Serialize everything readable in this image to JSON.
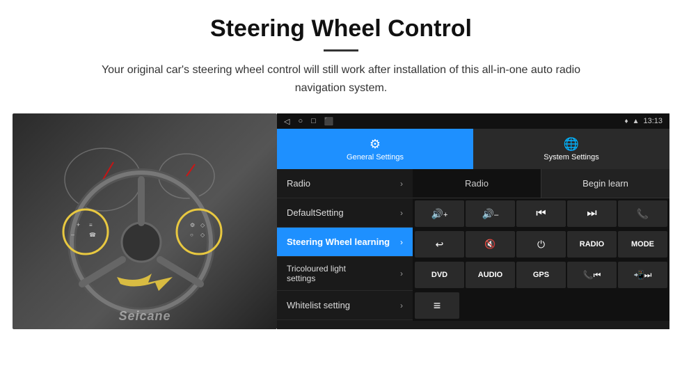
{
  "header": {
    "title": "Steering Wheel Control",
    "subtitle": "Your original car's steering wheel control will still work after installation of this all-in-one auto radio navigation system."
  },
  "status_bar": {
    "time": "13:13",
    "icons": [
      "◁",
      "○",
      "□",
      "⬛"
    ]
  },
  "tabs": {
    "general": {
      "label": "General Settings",
      "icon": "⚙"
    },
    "system": {
      "label": "System Settings",
      "icon": "🌐"
    }
  },
  "menu": {
    "items": [
      {
        "label": "Radio",
        "active": false
      },
      {
        "label": "DefaultSetting",
        "active": false
      },
      {
        "label": "Steering Wheel learning",
        "active": true
      },
      {
        "label": "Tricoloured light settings",
        "active": false
      },
      {
        "label": "Whitelist setting",
        "active": false
      }
    ]
  },
  "controls": {
    "begin_learn": "Begin learn",
    "radio_label": "Radio",
    "row1": [
      {
        "label": "🔊+",
        "type": "vol_up"
      },
      {
        "label": "🔊–",
        "type": "vol_dn"
      },
      {
        "label": "⏮",
        "type": "prev"
      },
      {
        "label": "⏭",
        "type": "next"
      },
      {
        "label": "📞",
        "type": "call"
      }
    ],
    "row2": [
      {
        "label": "↩",
        "type": "back"
      },
      {
        "label": "🔇",
        "type": "mute"
      },
      {
        "label": "⏻",
        "type": "power"
      },
      {
        "label": "RADIO",
        "type": "radio"
      },
      {
        "label": "MODE",
        "type": "mode"
      }
    ],
    "row3": [
      {
        "label": "DVD",
        "type": "dvd"
      },
      {
        "label": "AUDIO",
        "type": "audio"
      },
      {
        "label": "GPS",
        "type": "gps"
      },
      {
        "label": "📞⏮",
        "type": "tel_prev"
      },
      {
        "label": "📲⏭",
        "type": "tel_next"
      }
    ],
    "row4": [
      {
        "label": "≡",
        "type": "menu_icon"
      }
    ]
  },
  "watermark": "Seicane"
}
